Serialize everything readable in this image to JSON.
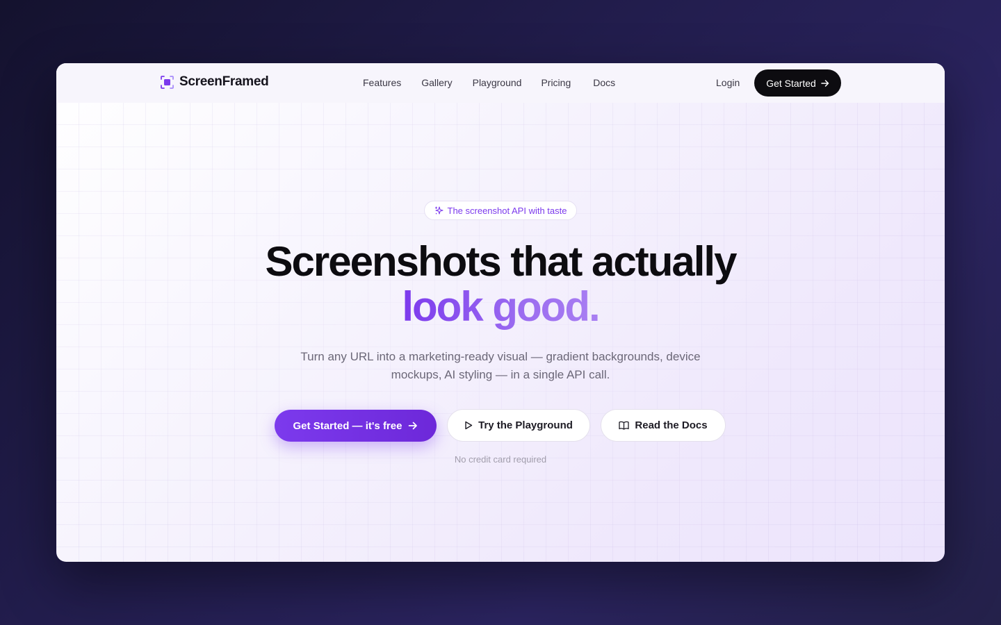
{
  "brand": {
    "name": "ScreenFramed",
    "accent_color": "#7c3aed"
  },
  "nav": {
    "links": [
      "Features",
      "Gallery",
      "Playground",
      "Pricing",
      "Docs"
    ],
    "login_label": "Login",
    "cta_label": "Get Started"
  },
  "hero": {
    "badge_text": "The screenshot API with taste",
    "headline_line1": "Screenshots that actually",
    "headline_line2": "look good.",
    "subtext_line1": "Turn any URL into a marketing-ready visual — gradient backgrounds, device",
    "subtext_line2": "mockups, AI styling — in a single API call.",
    "primary_cta": "Get Started — it's free",
    "playground_cta": "Try the Playground",
    "docs_cta": "Read the Docs",
    "note": "No credit card required"
  },
  "icons": {
    "logo": "screen-frame-icon",
    "badge": "sparkle-icon",
    "cta_arrow": "arrow-right-icon",
    "playground": "play-icon",
    "docs": "book-open-icon"
  }
}
